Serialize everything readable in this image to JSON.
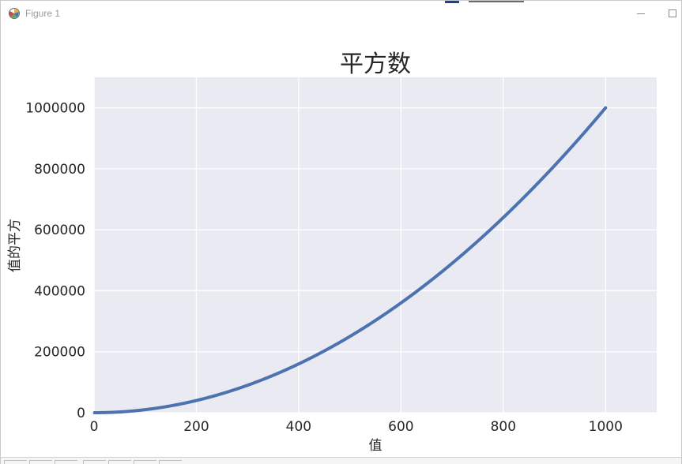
{
  "window": {
    "title": "Figure 1",
    "icon": "matplotlib-icon",
    "buttons": [
      "minimize-button",
      "maximize-button"
    ]
  },
  "chart_data": {
    "type": "scatter",
    "title": "平方数",
    "xlabel": "值",
    "ylabel": "值的平方",
    "xlim": [
      0,
      1100
    ],
    "ylim": [
      0,
      1100000
    ],
    "xticks": [
      0,
      200,
      400,
      600,
      800,
      1000
    ],
    "yticks": [
      0,
      200000,
      400000,
      600000,
      800000,
      1000000
    ],
    "x_range": [
      1,
      1000
    ],
    "function": "y = x^2",
    "grid": true,
    "background": "#eaeaf2",
    "series_color": "#4c72b0"
  }
}
